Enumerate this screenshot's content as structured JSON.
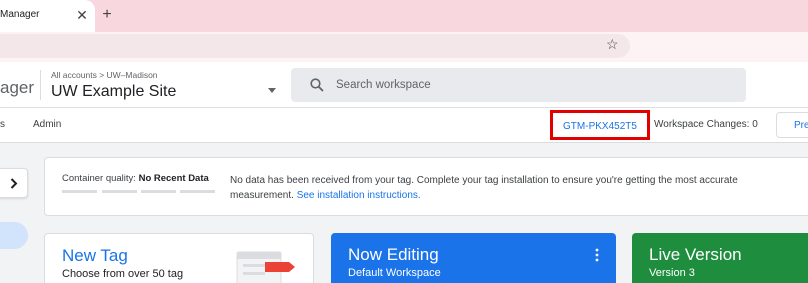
{
  "browser": {
    "tab_title": "Manager",
    "tab_close": "✕",
    "new_tab": "+",
    "star": "☆"
  },
  "header": {
    "product_name": "ager",
    "breadcrumb": "All accounts > UW–Madison",
    "container_name": "UW Example Site",
    "search_placeholder": "Search workspace"
  },
  "nav": {
    "item_partial": "s",
    "admin": "Admin",
    "container_id": "GTM-PKX452T5",
    "workspace_changes": "Workspace Changes: 0",
    "preview": "Pre"
  },
  "quality": {
    "label": "Container quality:",
    "value": "No Recent Data",
    "message": "No data has been received from your tag. Complete your tag installation to ensure you're getting the most accurate measurement.",
    "link": "See installation instructions."
  },
  "cards": {
    "new_tag_title": "New Tag",
    "new_tag_sub": "Choose from over 50 tag",
    "editing_title": "Now Editing",
    "editing_sub": "Default Workspace",
    "live_title": "Live Version",
    "live_sub": "Version 3"
  },
  "colors": {
    "accent": "#1a73e8",
    "live_green": "#1e8e3e",
    "highlight_red": "#e00000"
  }
}
